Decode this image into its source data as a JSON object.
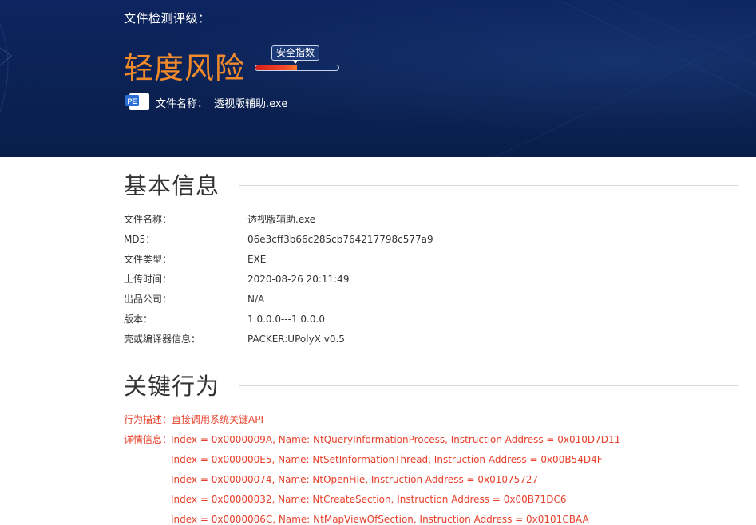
{
  "header": {
    "grade_label": "文件检测评级：",
    "risk_level": "轻度风险",
    "safety_index_label": "安全指数",
    "safety_index_fraction": 0.5,
    "pe_badge": "PE",
    "file_name_label": "文件名称：",
    "file_name_value": "透视版辅助.exe",
    "colors": {
      "banner_bg": "#0b2152",
      "risk_orange": "#f08a2a",
      "meter_red": "#e02a1e"
    }
  },
  "basic_info": {
    "title": "基本信息",
    "rows": [
      {
        "key": "文件名称：",
        "value": "透视版辅助.exe"
      },
      {
        "key": "MD5：",
        "value": "06e3cff3b66c285cb764217798c577a9"
      },
      {
        "key": "文件类型：",
        "value": "EXE"
      },
      {
        "key": "上传时间：",
        "value": "2020-08-26 20:11:49"
      },
      {
        "key": "出品公司：",
        "value": "N/A"
      },
      {
        "key": "版本：",
        "value": "1.0.0.0---1.0.0.0"
      },
      {
        "key": "壳或编译器信息：",
        "value": "PACKER:UPolyX v0.5"
      }
    ]
  },
  "key_behavior": {
    "title": "关键行为",
    "description_label": "行为描述：",
    "description_value": "直接调用系统关键API",
    "details_label": "详情信息：",
    "details": [
      "Index = 0x0000009A, Name: NtQueryInformationProcess, Instruction Address = 0x010D7D11",
      "Index = 0x000000E5, Name: NtSetInformationThread, Instruction Address = 0x00B54D4F",
      "Index = 0x00000074, Name: NtOpenFile, Instruction Address = 0x01075727",
      "Index = 0x00000032, Name: NtCreateSection, Instruction Address = 0x00B71DC6",
      "Index = 0x0000006C, Name: NtMapViewOfSection, Instruction Address = 0x0101CBAA"
    ],
    "color": "#e8402a"
  }
}
